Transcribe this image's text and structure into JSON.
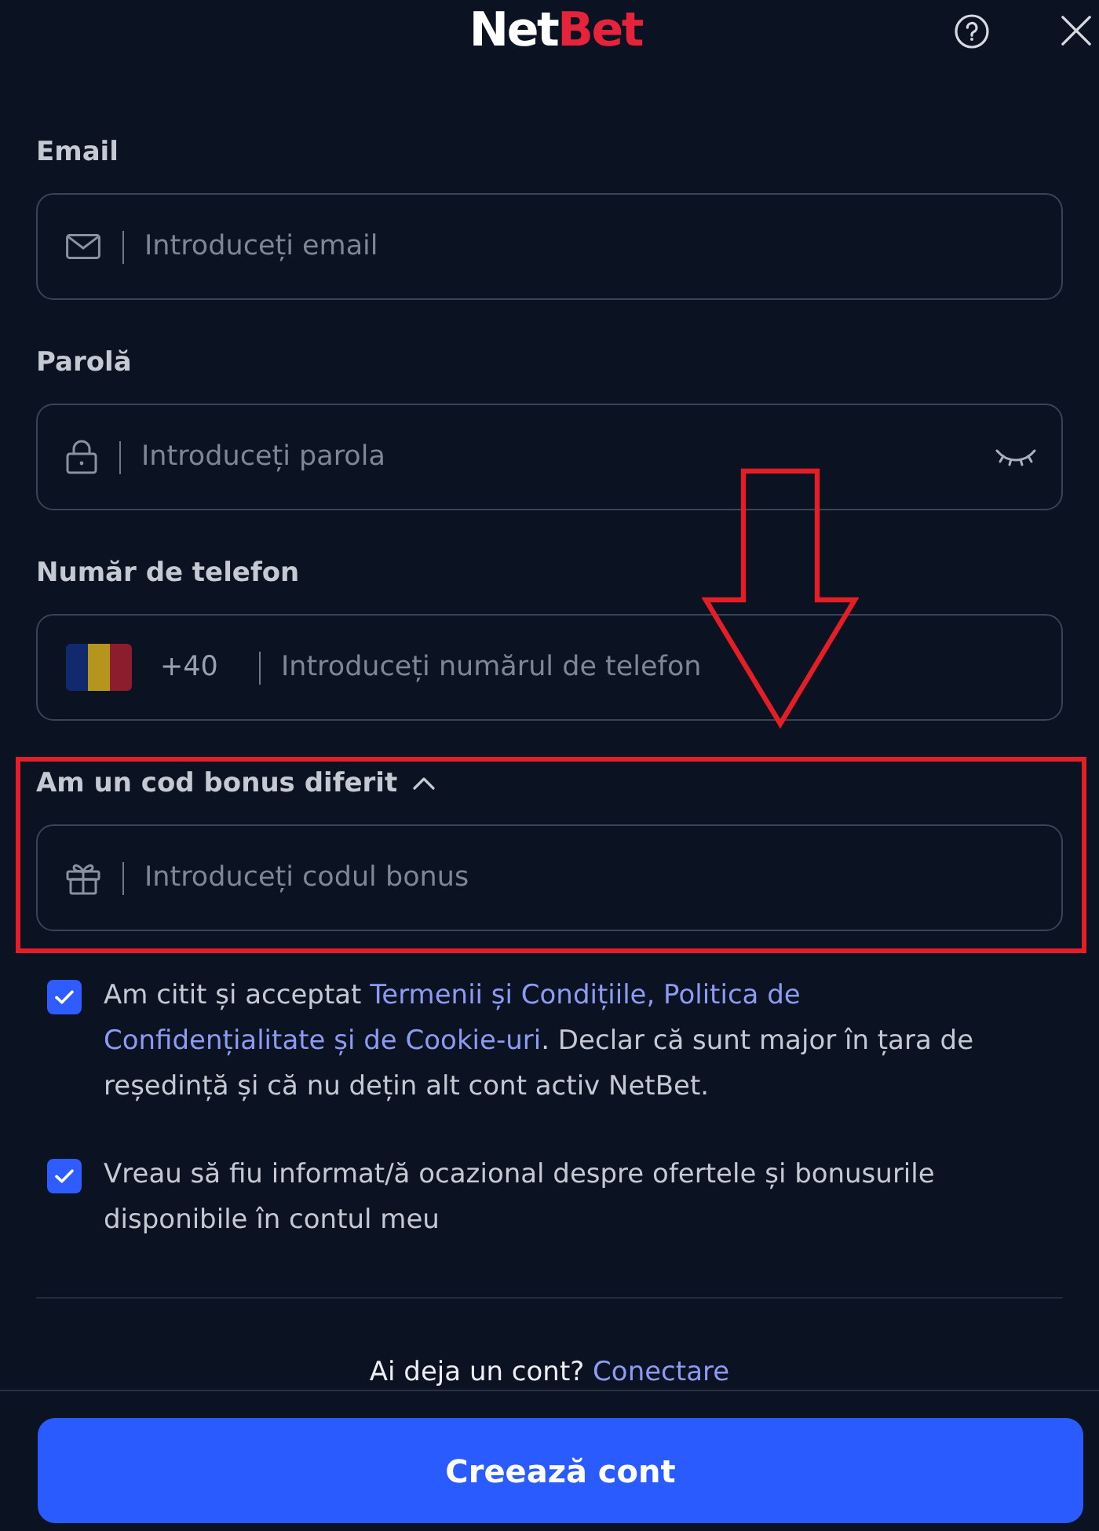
{
  "header": {
    "logo": [
      {
        "text": "Net",
        "color": "#ffffff"
      },
      {
        "text": "Bet",
        "color": "#e5243b"
      }
    ]
  },
  "fields": [
    {
      "kind": "email",
      "label": "Email",
      "placeholder": "Introduceți email"
    },
    {
      "kind": "password",
      "label": "Parolă",
      "placeholder": "Introduceți parola"
    },
    {
      "kind": "phone",
      "label": "Număr de telefon",
      "dial_code": "+40",
      "placeholder": "Introduceți numărul de telefon"
    }
  ],
  "bonus": {
    "label": "Am un cod bonus diferit",
    "expanded": true,
    "placeholder": "Introduceți codul bonus"
  },
  "consents": [
    {
      "checked": true,
      "text": [
        {
          "kind": "plain",
          "text": "Am citit și acceptat "
        },
        {
          "kind": "link",
          "text": "Termenii și Condițiile, Politica de"
        },
        {
          "kind": "link",
          "text": "Confidențialitate și de Cookie-uri"
        },
        {
          "kind": "plain",
          "text": ". Declar că sunt major în țara de reședință și că nu dețin alt cont activ NetBet."
        }
      ]
    },
    {
      "checked": true,
      "text": [
        {
          "kind": "plain",
          "text": "Vreau să fiu informat/ă ocazional despre ofertele și bonusurile disponibile în contul meu"
        }
      ]
    }
  ],
  "login_prompt": {
    "text": "Ai deja un cont?",
    "link": "Conectare"
  },
  "submit_button": "Creează cont"
}
